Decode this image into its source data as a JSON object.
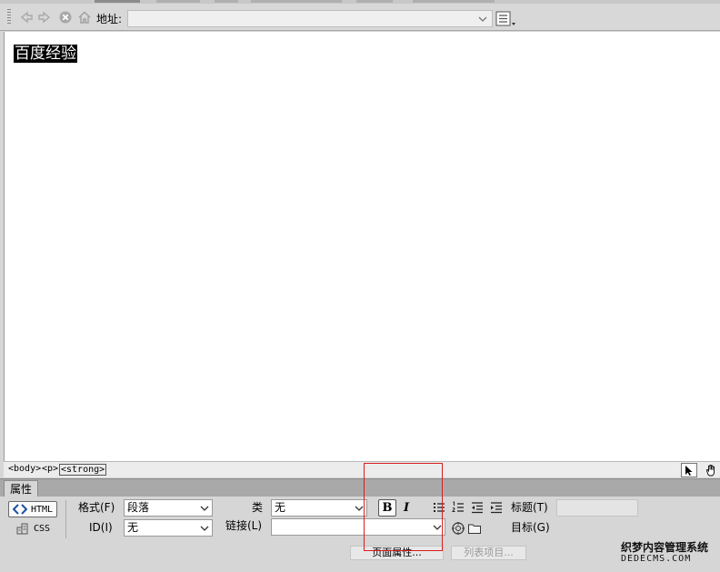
{
  "toolbar": {
    "address_label": "地址:",
    "address_value": ""
  },
  "document": {
    "content_text": "百度经验"
  },
  "tag_selector": {
    "tags": [
      "<body>",
      "<p>",
      "<strong>"
    ]
  },
  "properties": {
    "tab_label": "属性",
    "html_button_label": "HTML",
    "css_button_label": "CSS",
    "format_label": "格式(F)",
    "format_value": "段落",
    "id_label": "ID(I)",
    "id_value": "无",
    "class_label": "类",
    "class_value": "无",
    "link_label": "链接(L)",
    "link_value": "",
    "bold_label": "B",
    "italic_label": "I",
    "title_label": "标题(T)",
    "title_value": "",
    "target_label": "目标(G)",
    "page_properties_label": "页面属性...",
    "list_item_label": "列表项目..."
  },
  "watermark": {
    "line1": "织梦内容管理系统",
    "line2": "DEDECMS.COM"
  },
  "colors": {
    "highlight_box": "#d81e1e",
    "panel_bg": "#d6d6d6",
    "selection_bg": "#000000"
  },
  "icons": [
    "back-arrow-icon",
    "forward-arrow-icon",
    "stop-icon",
    "home-icon",
    "view-options-icon",
    "select-pointer-icon",
    "hand-tool-icon",
    "html-code-icon",
    "css-icon",
    "unordered-list-icon",
    "ordered-list-icon",
    "outdent-icon",
    "indent-icon",
    "point-to-file-icon",
    "browse-folder-icon"
  ]
}
